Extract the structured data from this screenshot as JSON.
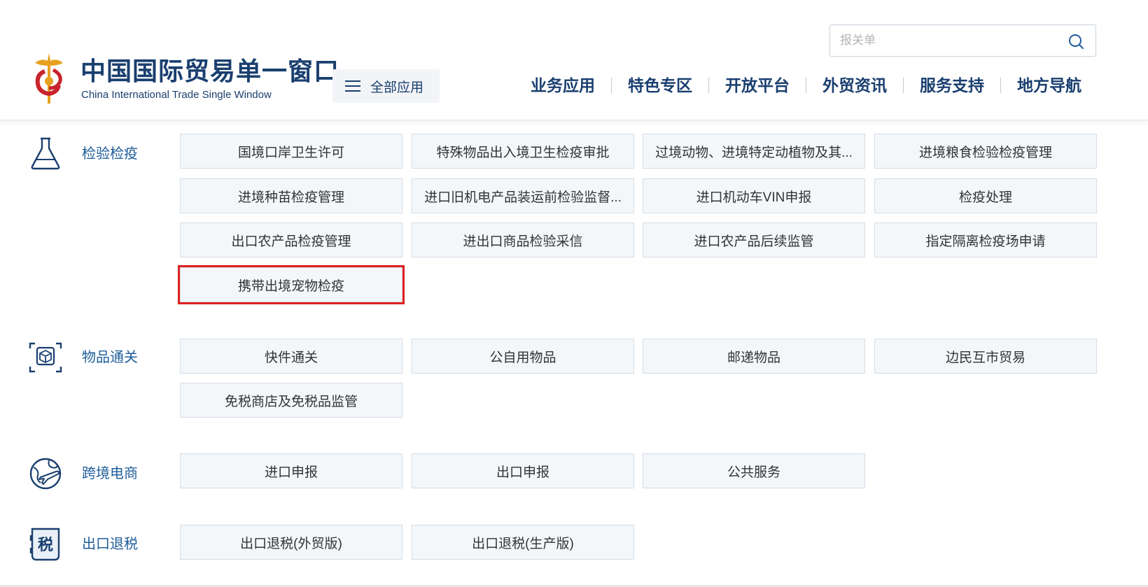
{
  "header": {
    "brand_cn": "中国国际贸易单一窗口",
    "brand_en": "China International Trade Single Window",
    "all_apps_label": "全部应用",
    "search_placeholder": "报关单",
    "nav": [
      "业务应用",
      "特色专区",
      "开放平台",
      "外贸资讯",
      "服务支持",
      "地方导航"
    ]
  },
  "categories": [
    {
      "label": "检验检疫",
      "icon": "flask-icon",
      "items": [
        "国境口岸卫生许可",
        "特殊物品出入境卫生检疫审批",
        "过境动物、进境特定动植物及其...",
        "进境粮食检验检疫管理",
        "进境种苗检疫管理",
        "进口旧机电产品装运前检验监督...",
        "进口机动车VIN申报",
        "检疫处理",
        "出口农产品检疫管理",
        "进出口商品检验采信",
        "进口农产品后续监管",
        "指定隔离检疫场申请",
        "携带出境宠物检疫"
      ]
    },
    {
      "label": "物品通关",
      "icon": "package-scan-icon",
      "items": [
        "快件通关",
        "公自用物品",
        "邮递物品",
        "边民互市贸易",
        "免税商店及免税品监管"
      ]
    },
    {
      "label": "跨境电商",
      "icon": "globe-plane-icon",
      "items": [
        "进口申报",
        "出口申报",
        "公共服务"
      ]
    },
    {
      "label": "出口退税",
      "icon": "tax-document-icon",
      "icon_text": "税",
      "items": [
        "出口退税(外贸版)",
        "出口退税(生产版)"
      ]
    }
  ],
  "highlighted_item": "携带出境宠物检疫",
  "colors": {
    "brand": "#1a3f6f",
    "category_label": "#1f5d9a",
    "tile_bg": "#f3f7fa",
    "tile_border": "#d4dde6",
    "highlight": "#e02020"
  }
}
